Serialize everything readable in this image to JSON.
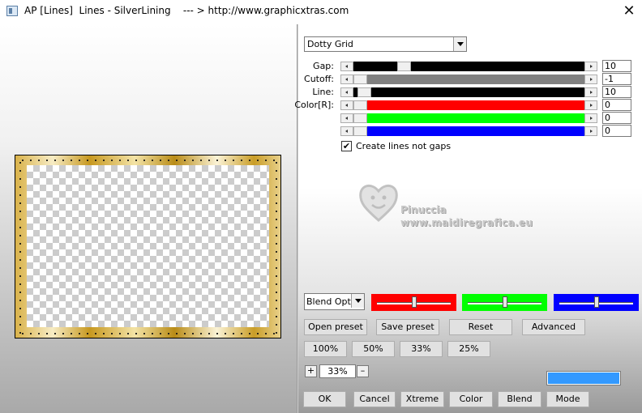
{
  "window": {
    "title": "AP [Lines]  Lines - SilverLining    --- > http://www.graphicxtras.com",
    "close_glyph": "✕"
  },
  "preset": {
    "selected": "Dotty Grid"
  },
  "sliders": [
    {
      "label": "Gap:",
      "value": "10",
      "track_color": "#000000",
      "thumb_fraction": 0.2
    },
    {
      "label": "Cutoff:",
      "value": "-1",
      "track_color": "#808080",
      "thumb_fraction": 0.0
    },
    {
      "label": "Line:",
      "value": "10",
      "track_color": "#000000",
      "thumb_fraction": 0.02
    },
    {
      "label": "Color[R]:",
      "value": "0",
      "track_color": "#ff0000",
      "thumb_fraction": 0.0
    },
    {
      "label": "",
      "value": "0",
      "track_color": "#00ff00",
      "thumb_fraction": 0.0
    },
    {
      "label": "",
      "value": "0",
      "track_color": "#0000ff",
      "thumb_fraction": 0.0
    }
  ],
  "checkbox": {
    "label": "Create lines not gaps",
    "checked": true,
    "mark": "✔"
  },
  "watermark": {
    "name": "Pinuccia",
    "url": "www.maidiregrafica.eu"
  },
  "blend": {
    "selected": "Blend Options",
    "channels": [
      {
        "color": "#ff0000",
        "level": 0.5
      },
      {
        "color": "#00ff00",
        "level": 0.5
      },
      {
        "color": "#0000ff",
        "level": 0.5
      }
    ]
  },
  "buttons_row1": [
    "Open preset",
    "Save preset",
    "Reset",
    "Advanced"
  ],
  "zoom_buttons": [
    "100%",
    "50%",
    "33%",
    "25%"
  ],
  "zoom": {
    "plus": "+",
    "value": "33%",
    "minus": "–"
  },
  "swatch_color": "#3399ff",
  "bottom_buttons": [
    "OK",
    "Cancel",
    "Xtreme",
    "Color",
    "Blend",
    "Mode"
  ]
}
